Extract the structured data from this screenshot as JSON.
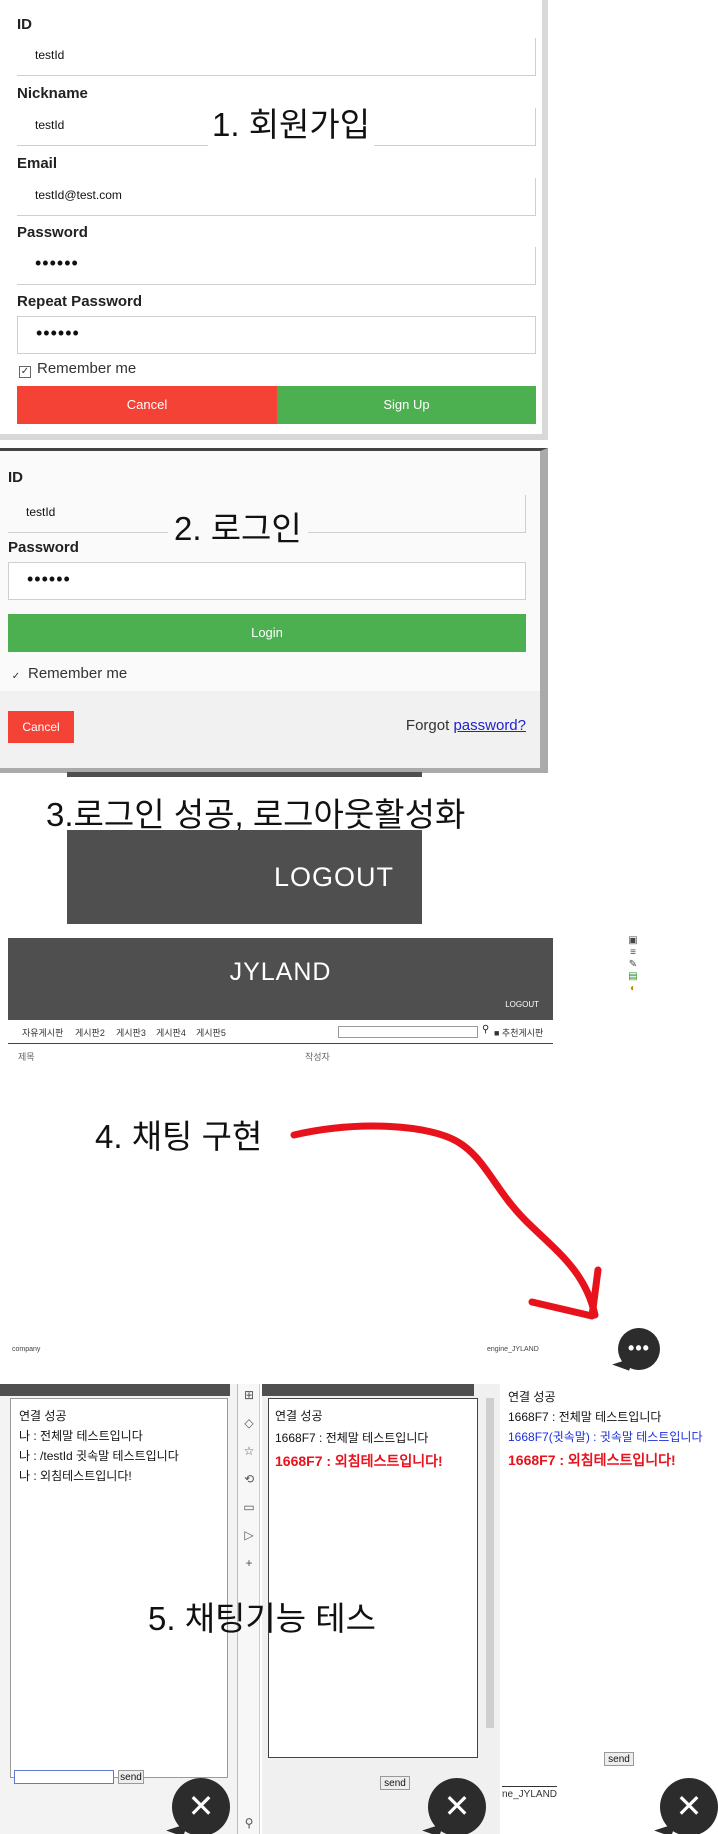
{
  "signup": {
    "caption": "1. 회원가입",
    "id_label": "ID",
    "id_value": "testId",
    "nickname_label": "Nickname",
    "nickname_value": "testId",
    "email_label": "Email",
    "email_value": "testId@test.com",
    "password_label": "Password",
    "password_value": "••••••",
    "repeat_label": "Repeat Password",
    "repeat_value": "••••••",
    "remember_label": "Remember me",
    "cancel_label": "Cancel",
    "signup_label": "Sign Up"
  },
  "login": {
    "caption": "2. 로그인",
    "id_label": "ID",
    "id_value": "testId",
    "password_label": "Password",
    "password_value": "••••••",
    "login_label": "Login",
    "remember_label": "Remember me",
    "cancel_label": "Cancel",
    "forgot_text": "Forgot",
    "forgot_link": "password?"
  },
  "logout_section": {
    "caption": "3.로그인 성공, 로그아웃활성화",
    "logout_label": "LOGOUT"
  },
  "site": {
    "title": "JYLAND",
    "logout_small": "LOGOUT",
    "nav_items": [
      "자유게시판",
      "게시판2",
      "게시판3",
      "게시판4",
      "게시판5"
    ],
    "left_column": "제목",
    "right_column": "작성자",
    "search_extra": "■ 추천게시판"
  },
  "chat_caption": {
    "caption": "4. 채팅 구현"
  },
  "footer_strip": {
    "left": "company",
    "right": "engine_JYLAND"
  },
  "chat_test": {
    "caption": "5. 채팅기능 테스",
    "window1": {
      "lines": [
        "연결 성공",
        "나 : 전체말 테스트입니다",
        "나 : /testId 귓속말 테스트입니다",
        "나 : 외침테스트입니다!"
      ],
      "send_label": "send"
    },
    "window2": {
      "lines": [
        "연결 성공",
        "1668F7 : 전체말 테스트입니다"
      ],
      "shout": "1668F7 : 외침테스트입니다!",
      "send_label": "send"
    },
    "window3": {
      "lines": [
        "연결 성공",
        "1668F7 : 전체말 테스트입니다"
      ],
      "whisper": "1668F7(귓속말) : 귓속말 테스트입니다",
      "shout": "1668F7 : 외침테스트입니다!",
      "send_label": "send",
      "footer": "ne_JYLAND"
    }
  },
  "colors": {
    "red_button": "#f44336",
    "green_button": "#4caf50",
    "dark_header": "#4f4f4f",
    "whisper_blue": "#1a2fd9",
    "shout_red": "#e8121c",
    "arrow_red": "#e8121c"
  },
  "icons": [
    "chat-bubble-icon",
    "close-icon",
    "dots-icon",
    "search-icon",
    "grid-icon",
    "star-icon",
    "plus-icon"
  ]
}
